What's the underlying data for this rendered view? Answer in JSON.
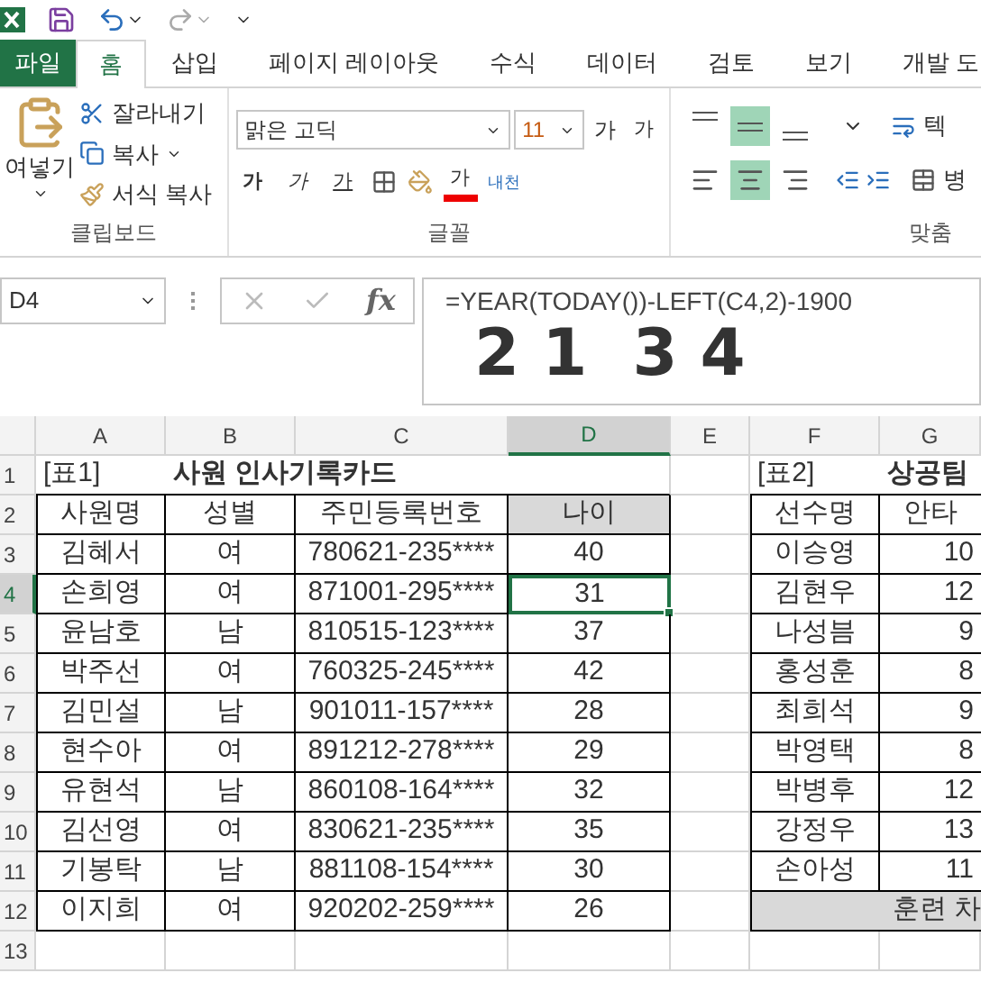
{
  "tabs": [
    {
      "label": "파일",
      "kind": "file",
      "selected": false
    },
    {
      "label": "홈",
      "kind": "tab",
      "selected": true
    },
    {
      "label": "삽입",
      "kind": "tab",
      "selected": false
    },
    {
      "label": "페이지 레이아웃",
      "kind": "tab",
      "selected": false
    },
    {
      "label": "수식",
      "kind": "tab",
      "selected": false
    },
    {
      "label": "데이터",
      "kind": "tab",
      "selected": false
    },
    {
      "label": "검토",
      "kind": "tab",
      "selected": false
    },
    {
      "label": "보기",
      "kind": "tab",
      "selected": false
    },
    {
      "label": "개발 도",
      "kind": "tab",
      "selected": false
    }
  ],
  "clipboard": {
    "paste": "여넣기",
    "cut": "잘라내기",
    "copy": "복사",
    "format_painter": "서식 복사",
    "label": "클립보드"
  },
  "font": {
    "name": "맑은 고딕",
    "size": "11",
    "grow": "가",
    "shrink": "가",
    "bold": "가",
    "italic": "가",
    "underline": "가",
    "font_color": "가",
    "phonetic": "내천",
    "label": "글꼴"
  },
  "alignment": {
    "vertical": [
      {
        "kind": "top",
        "selected": false
      },
      {
        "kind": "middle",
        "selected": true
      },
      {
        "kind": "bottom",
        "selected": false
      }
    ],
    "horizontal": [
      {
        "kind": "left",
        "selected": false
      },
      {
        "kind": "center",
        "selected": true
      },
      {
        "kind": "right",
        "selected": false
      }
    ],
    "label": "맞춤",
    "wrap": "텍",
    "merge": "병"
  },
  "name_box": "D4",
  "fx": "fx",
  "formula": "=YEAR(TODAY())-LEFT(C4,2)-1900",
  "handwriting": "2 1  3 4",
  "columns": [
    {
      "label": "A",
      "selected": false
    },
    {
      "label": "B",
      "selected": false
    },
    {
      "label": "C",
      "selected": false
    },
    {
      "label": "D",
      "selected": true
    },
    {
      "label": "E",
      "selected": false
    },
    {
      "label": "F",
      "selected": false
    },
    {
      "label": "G",
      "selected": false
    }
  ],
  "row_headers": [
    {
      "label": "1",
      "selected": false
    },
    {
      "label": "2",
      "selected": false
    },
    {
      "label": "3",
      "selected": false
    },
    {
      "label": "4",
      "selected": true
    },
    {
      "label": "5",
      "selected": false
    },
    {
      "label": "6",
      "selected": false
    },
    {
      "label": "7",
      "selected": false
    },
    {
      "label": "8",
      "selected": false
    },
    {
      "label": "9",
      "selected": false
    },
    {
      "label": "10",
      "selected": false
    },
    {
      "label": "11",
      "selected": false
    },
    {
      "label": "12",
      "selected": false
    },
    {
      "label": "13",
      "selected": false
    }
  ],
  "table1": {
    "label": "[표1]",
    "title": "사원 인사기록카드",
    "headers": [
      "사원명",
      "성별",
      "주민등록번호",
      "나이"
    ],
    "rows": [
      {
        "name": "김혜서",
        "gender": "여",
        "id": "780621-235****",
        "age": "40",
        "active": false
      },
      {
        "name": "손희영",
        "gender": "여",
        "id": "871001-295****",
        "age": "31",
        "active": true
      },
      {
        "name": "윤남호",
        "gender": "남",
        "id": "810515-123****",
        "age": "37",
        "active": false
      },
      {
        "name": "박주선",
        "gender": "여",
        "id": "760325-245****",
        "age": "42",
        "active": false
      },
      {
        "name": "김민설",
        "gender": "남",
        "id": "901011-157****",
        "age": "28",
        "active": false
      },
      {
        "name": "현수아",
        "gender": "여",
        "id": "891212-278****",
        "age": "29",
        "active": false
      },
      {
        "name": "유현석",
        "gender": "남",
        "id": "860108-164****",
        "age": "32",
        "active": false
      },
      {
        "name": "김선영",
        "gender": "여",
        "id": "830621-235****",
        "age": "35",
        "active": false
      },
      {
        "name": "기봉탁",
        "gender": "남",
        "id": "881108-154****",
        "age": "30",
        "active": false
      },
      {
        "name": "이지희",
        "gender": "여",
        "id": "920202-259****",
        "age": "26",
        "active": false
      }
    ]
  },
  "table2": {
    "label": "[표2]",
    "title": "상공팀",
    "headers": [
      "선수명",
      "안타"
    ],
    "rows": [
      {
        "name": "이승영",
        "hits": "10"
      },
      {
        "name": "김현우",
        "hits": "12"
      },
      {
        "name": "나성븜",
        "hits": "9"
      },
      {
        "name": "홍성훈",
        "hits": "8"
      },
      {
        "name": "최희석",
        "hits": "9"
      },
      {
        "name": "박영택",
        "hits": "8"
      },
      {
        "name": "박병후",
        "hits": "12"
      },
      {
        "name": "강정우",
        "hits": "13"
      },
      {
        "name": "손아성",
        "hits": "11"
      }
    ],
    "footer": "훈련 차"
  }
}
